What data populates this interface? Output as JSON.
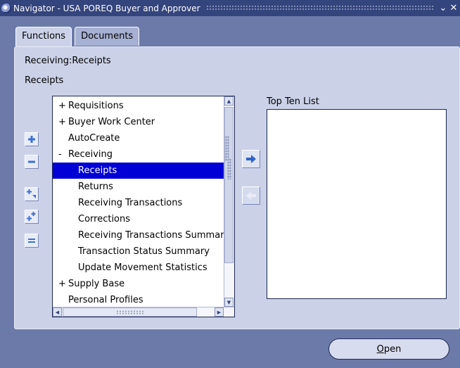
{
  "window": {
    "title": "Navigator - USA POREQ Buyer and Approver",
    "min_glyph": "⌄",
    "close_glyph": "✕"
  },
  "tabs": [
    {
      "label": "Functions",
      "active": true
    },
    {
      "label": "Documents",
      "active": false
    }
  ],
  "breadcrumb": "Receiving:Receipts",
  "current_function": "Receipts",
  "tree": {
    "items": [
      {
        "prefix": "+",
        "label": "Requisitions",
        "level": 0
      },
      {
        "prefix": "+",
        "label": "Buyer Work Center",
        "level": 0
      },
      {
        "prefix": "",
        "label": "AutoCreate",
        "level": 0
      },
      {
        "prefix": "-",
        "label": "Receiving",
        "level": 0
      },
      {
        "prefix": "",
        "label": "Receipts",
        "level": 1,
        "selected": true
      },
      {
        "prefix": "",
        "label": "Returns",
        "level": 1
      },
      {
        "prefix": "",
        "label": "Receiving Transactions",
        "level": 1
      },
      {
        "prefix": "",
        "label": "Corrections",
        "level": 1
      },
      {
        "prefix": "",
        "label": "Receiving Transactions Summary",
        "level": 1
      },
      {
        "prefix": "",
        "label": "Transaction Status Summary",
        "level": 1
      },
      {
        "prefix": "",
        "label": "Update Movement Statistics",
        "level": 1
      },
      {
        "prefix": "+",
        "label": "Supply Base",
        "level": 0
      },
      {
        "prefix": "",
        "label": "Personal Profiles",
        "level": 0
      }
    ]
  },
  "side_buttons": [
    {
      "name": "expand-button",
      "icon": "plus-icon"
    },
    {
      "name": "collapse-button",
      "icon": "minus-icon"
    },
    {
      "name": "expand-branch-button",
      "icon": "expand-branch-icon"
    },
    {
      "name": "expand-all-button",
      "icon": "expand-all-icon"
    },
    {
      "name": "collapse-all-button",
      "icon": "collapse-all-icon"
    }
  ],
  "top_ten": {
    "label": "Top Ten List",
    "items": []
  },
  "open_button": {
    "mnemonic": "O",
    "rest": "pen"
  },
  "colors": {
    "background": "#6b7aa8",
    "titlebar": "#34447c",
    "panel": "#cbd2e8",
    "selection": "#0000d6",
    "icon_blue": "#3d6fd6"
  }
}
